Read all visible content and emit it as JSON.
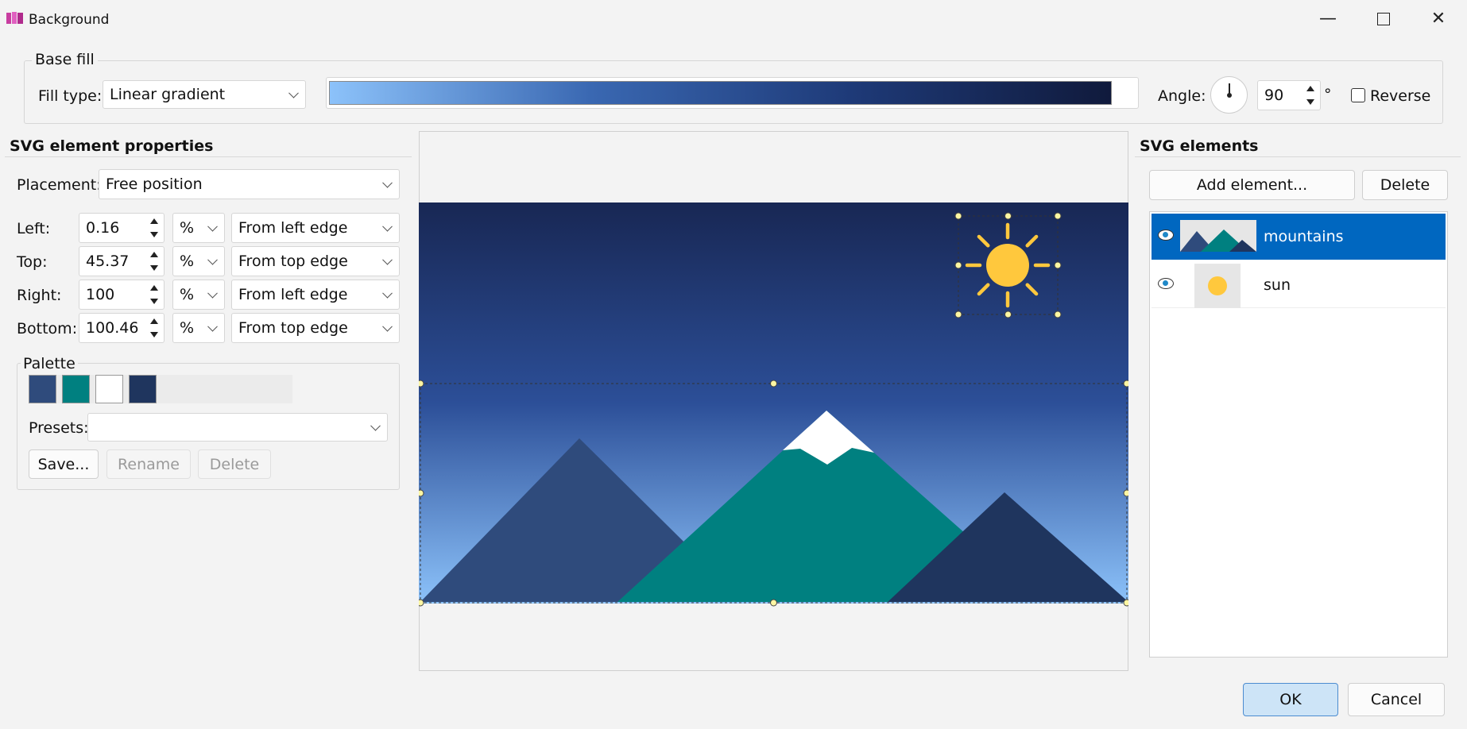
{
  "window": {
    "title": "Background",
    "minimize_icon": "minimize-icon",
    "maximize_icon": "maximize-icon",
    "close_icon": "close-icon"
  },
  "base_fill": {
    "group_label": "Base fill",
    "fill_type_label": "Fill type:",
    "fill_type_value": "Linear gradient",
    "gradient_colors": [
      "#8cc2fa",
      "#3a68b2",
      "#1e3a78",
      "#101a3c"
    ],
    "angle_label": "Angle:",
    "angle_value": "90",
    "degree_symbol": "°",
    "reverse_label": "Reverse",
    "reverse_checked": false
  },
  "props": {
    "title": "SVG element properties",
    "placement_label": "Placement:",
    "placement_value": "Free position",
    "rows": [
      {
        "label": "Left:",
        "value": "0.16",
        "unit": "%",
        "ref": "From left edge"
      },
      {
        "label": "Top:",
        "value": "45.37",
        "unit": "%",
        "ref": "From top edge"
      },
      {
        "label": "Right:",
        "value": "100",
        "unit": "%",
        "ref": "From left edge"
      },
      {
        "label": "Bottom:",
        "value": "100.46",
        "unit": "%",
        "ref": "From top edge"
      }
    ],
    "palette": {
      "label": "Palette",
      "colors": [
        "#2f4b7c",
        "#008080",
        "#ffffff",
        "#1f355e"
      ],
      "presets_label": "Presets:",
      "presets_value": "",
      "save_label": "Save...",
      "rename_label": "Rename",
      "delete_label": "Delete"
    }
  },
  "elements": {
    "title": "SVG elements",
    "add_label": "Add element...",
    "delete_label": "Delete",
    "items": [
      {
        "name": "mountains",
        "visible": true,
        "selected": true,
        "icon": "eye-icon"
      },
      {
        "name": "sun",
        "visible": true,
        "selected": false,
        "icon": "eye-icon"
      }
    ]
  },
  "preview": {
    "sky_colors": [
      "#182754",
      "#2c4f98",
      "#8cc2fa"
    ],
    "mountain_colors": [
      "#2f4b7c",
      "#008080",
      "#1f355e",
      "#ffffff"
    ],
    "sun_color": "#ffc83d"
  },
  "footer": {
    "ok_label": "OK",
    "cancel_label": "Cancel"
  },
  "colors": {
    "selection": "#0067c0",
    "window_bg": "#f3f3f3"
  }
}
